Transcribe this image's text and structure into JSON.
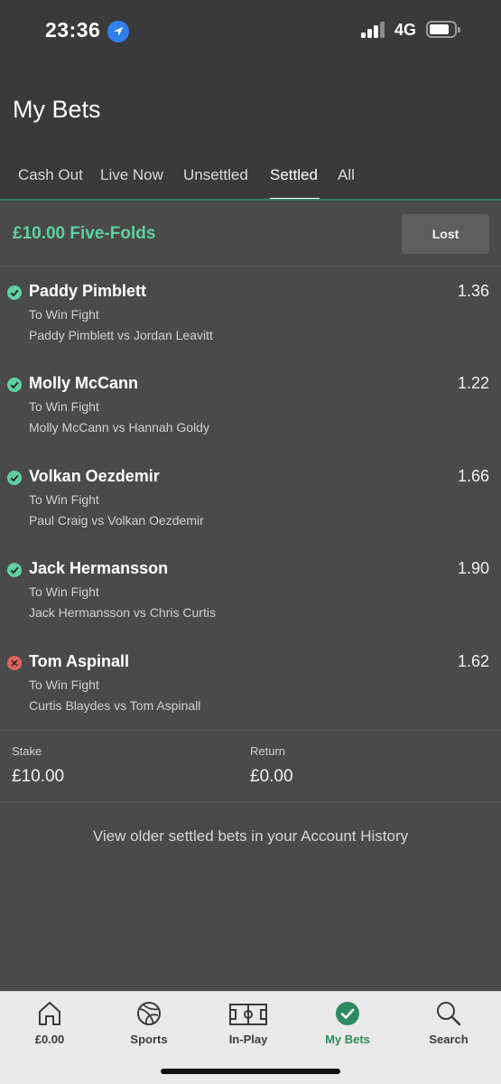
{
  "status_bar": {
    "time": "23:36",
    "network": "4G"
  },
  "header": {
    "title": "My Bets"
  },
  "tabs": [
    {
      "label": "Cash Out"
    },
    {
      "label": "Live Now"
    },
    {
      "label": "Unsettled"
    },
    {
      "label": "Settled",
      "active": true
    },
    {
      "label": "All"
    }
  ],
  "bet": {
    "title": "£10.00 Five-Folds",
    "status": "Lost",
    "selections": [
      {
        "name": "Paddy Pimblett",
        "odds": "1.36",
        "market": "To Win Fight",
        "event": "Paddy Pimblett vs Jordan Leavitt",
        "result": "won"
      },
      {
        "name": "Molly McCann",
        "odds": "1.22",
        "market": "To Win Fight",
        "event": "Molly McCann vs Hannah Goldy",
        "result": "won"
      },
      {
        "name": "Volkan Oezdemir",
        "odds": "1.66",
        "market": "To Win Fight",
        "event": "Paul Craig vs Volkan Oezdemir",
        "result": "won"
      },
      {
        "name": "Jack Hermansson",
        "odds": "1.90",
        "market": "To Win Fight",
        "event": "Jack Hermansson vs Chris Curtis",
        "result": "won"
      },
      {
        "name": "Tom Aspinall",
        "odds": "1.62",
        "market": "To Win Fight",
        "event": "Curtis Blaydes vs Tom Aspinall",
        "result": "lost"
      }
    ],
    "stake_label": "Stake",
    "stake_value": "£10.00",
    "return_label": "Return",
    "return_value": "£0.00"
  },
  "history_link": "View older settled bets in your Account History",
  "bottom_nav": [
    {
      "label": "£0.00",
      "icon": "home-icon"
    },
    {
      "label": "Sports",
      "icon": "football-icon"
    },
    {
      "label": "In-Play",
      "icon": "pitch-icon"
    },
    {
      "label": "My Bets",
      "icon": "check-circle-icon",
      "active": true
    },
    {
      "label": "Search",
      "icon": "search-icon"
    }
  ],
  "colors": {
    "accent": "#5fd0a2",
    "won": "#5fd0a2",
    "lost": "#e0645c",
    "nav_active": "#2e8a61"
  }
}
